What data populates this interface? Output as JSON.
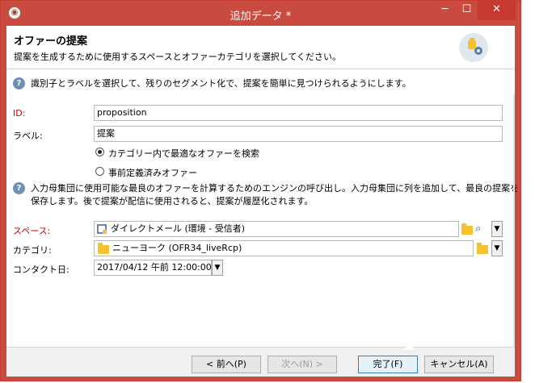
{
  "window": {
    "title": "追加データ *",
    "min": "─",
    "max": "☐",
    "close": "✕"
  },
  "header": {
    "title": "オファーの提案",
    "subtitle": "提案を生成するために使用するスペースとオファーカテゴリを選択してください。"
  },
  "info1": "識別子とラベルを選択して、残りのセグメント化で、提案を簡単に見つけられるようにします。",
  "id_field": {
    "label": "ID:",
    "value": "proposition"
  },
  "label_field": {
    "label": "ラベル:",
    "value": "提案"
  },
  "radios": [
    {
      "label": "カテゴリー内で最適なオファーを検索",
      "selected": true
    },
    {
      "label": "事前定義済みオファー",
      "selected": false
    }
  ],
  "info2": {
    "line1": "入力母集団に使用可能な最良のオファーを計算するためのエンジンの呼び出し。入力母集団に列を追加して、最良の提案を",
    "line2": "保存します。後で提案が配信に使用されると、提案が履歴化されます。"
  },
  "space_field": {
    "label": "スペース:",
    "value": "ダイレクトメール (環境 - 受信者)"
  },
  "category_field": {
    "label": "カテゴリ:",
    "value": "ニューヨーク (OFR34_liveRcp)"
  },
  "contact_field": {
    "label": "コンタクト日:",
    "value": "2017/04/12 午前 12:00:00"
  },
  "buttons": {
    "back": "< 前へ(P)",
    "next": "次へ(N) >",
    "finish": "完了(F)",
    "cancel": "キャンセル(A)"
  },
  "icons": {
    "info": "info-icon",
    "folder": "folder-icon",
    "search": "search-icon",
    "dropdown": "chevron-down-icon"
  }
}
